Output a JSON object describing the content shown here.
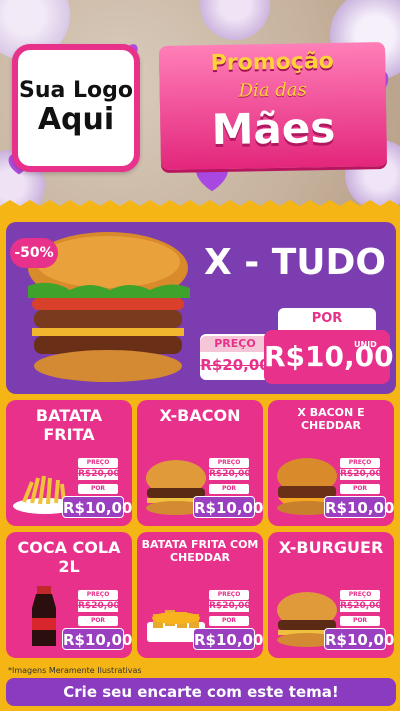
{
  "logo": {
    "line1": "Sua Logo",
    "line2": "Aqui"
  },
  "promo": {
    "line1": "Promoção",
    "line2": "Dia das",
    "line3": "Mães"
  },
  "featured": {
    "discount": "-50%",
    "title": "X - TUDO",
    "preco_label": "PREÇO",
    "old_price": "R$20,00",
    "por_label": "POR",
    "new_price": "R$10,00",
    "unid_label": "UNID"
  },
  "products": [
    {
      "title": "BATATA FRITA",
      "preco_label": "PREÇO",
      "old_price": "R$20,00",
      "por_label": "POR",
      "new_price": "R$10,00",
      "image": "fries-icon"
    },
    {
      "title": "X-BACON",
      "preco_label": "PREÇO",
      "old_price": "R$20,00",
      "por_label": "POR",
      "new_price": "R$10,00",
      "image": "burger-icon"
    },
    {
      "title": "X BACON E CHEDDAR",
      "preco_label": "PREÇO",
      "old_price": "R$20,00",
      "por_label": "POR",
      "new_price": "R$10,00",
      "image": "cheeseburger-icon"
    },
    {
      "title": "COCA COLA 2L",
      "preco_label": "PREÇO",
      "old_price": "R$20,00",
      "por_label": "POR",
      "new_price": "R$10,00",
      "image": "soda-bottle-icon"
    },
    {
      "title": "BATATA FRITA COM CHEDDAR",
      "preco_label": "PREÇO",
      "old_price": "R$20,00",
      "por_label": "POR",
      "new_price": "R$10,00",
      "image": "cheddar-fries-icon"
    },
    {
      "title": "X-BURGUER",
      "preco_label": "PREÇO",
      "old_price": "R$20,00",
      "por_label": "POR",
      "new_price": "R$10,00",
      "image": "burger-icon"
    }
  ],
  "footer": {
    "note": "*Imagens Meramente Ilustrativas",
    "cta": "Crie seu encarte com este tema!"
  },
  "colors": {
    "pink": "#e7318a",
    "purple": "#7b3db0",
    "yellow": "#f5b514",
    "gold": "#ffd23a"
  }
}
